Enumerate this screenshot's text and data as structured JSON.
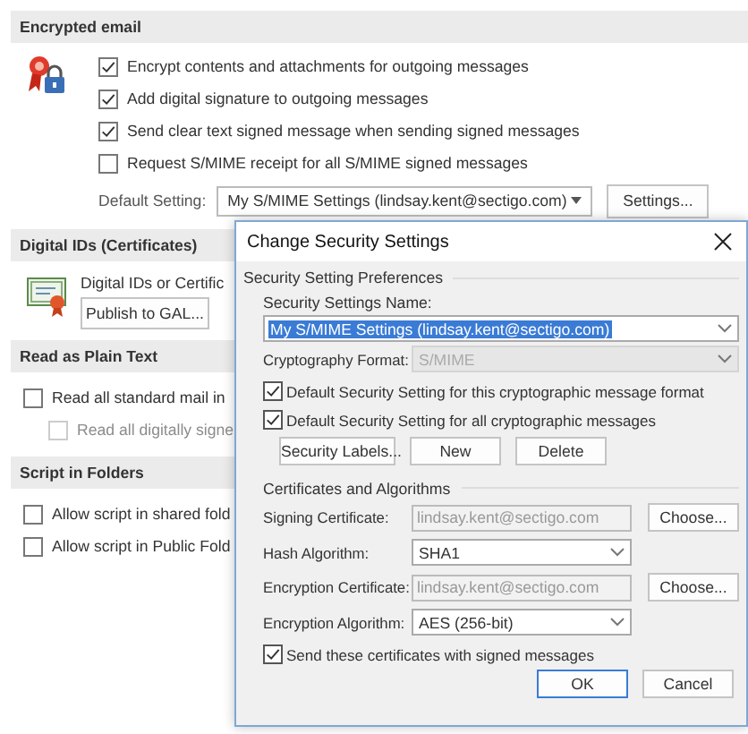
{
  "encrypted_email": {
    "title": "Encrypted email",
    "options": [
      {
        "label": "Encrypt contents and attachments for outgoing messages",
        "checked": true
      },
      {
        "label": "Add digital signature to outgoing messages",
        "checked": true
      },
      {
        "label": "Send clear text signed message when sending signed messages",
        "checked": true
      },
      {
        "label": "Request S/MIME receipt for all S/MIME signed messages",
        "checked": false
      }
    ],
    "default_setting_label": "Default Setting:",
    "default_setting_value": "My S/MIME Settings (lindsay.kent@sectigo.com)",
    "settings_button": "Settings..."
  },
  "digital_ids": {
    "title": "Digital IDs (Certificates)",
    "description": "Digital IDs or Certific",
    "publish_button": "Publish to GAL..."
  },
  "read_as_plain_text": {
    "title": "Read as Plain Text",
    "options": [
      {
        "label": "Read all standard mail in",
        "checked": false,
        "disabled": false,
        "children": [
          {
            "label": "Read all digitally signe",
            "checked": false,
            "disabled": true
          }
        ]
      }
    ]
  },
  "script_in_folders": {
    "title": "Script in Folders",
    "options": [
      {
        "label": "Allow script in shared fold",
        "checked": false,
        "disabled": false
      },
      {
        "label": "Allow script in Public Fold",
        "checked": false,
        "disabled": false
      }
    ]
  },
  "dialog": {
    "title": "Change Security Settings",
    "group_label": "Security Setting Preferences",
    "name_label": "Security Settings Name:",
    "name_value": "My S/MIME Settings (lindsay.kent@sectigo.com)",
    "crypto_label": "Cryptography Format:",
    "crypto_value": "S/MIME",
    "crypto_disabled": true,
    "default_options": [
      {
        "label": "Default Security Setting for this cryptographic message format",
        "checked": true
      },
      {
        "label": "Default Security Setting for all cryptographic messages",
        "checked": true
      }
    ],
    "buttons": [
      "Security Labels...",
      "New",
      "Delete"
    ],
    "cert_group_label": "Certificates and Algorithms",
    "cert_rows": [
      {
        "kind": "text",
        "label": "Signing Certificate:",
        "value": "lindsay.kent@sectigo.com",
        "disabled": true,
        "button": "Choose..."
      },
      {
        "kind": "select",
        "label": "Hash Algorithm:",
        "value": "SHA1"
      },
      {
        "kind": "text",
        "label": "Encryption Certificate:",
        "value": "lindsay.kent@sectigo.com",
        "disabled": true,
        "button": "Choose..."
      },
      {
        "kind": "select",
        "label": "Encryption Algorithm:",
        "value": "AES (256-bit)"
      }
    ],
    "send_option": {
      "label": "Send these certificates with signed messages",
      "checked": true
    },
    "footer_buttons": [
      {
        "label": "OK",
        "default": true
      },
      {
        "label": "Cancel",
        "default": false
      }
    ]
  }
}
